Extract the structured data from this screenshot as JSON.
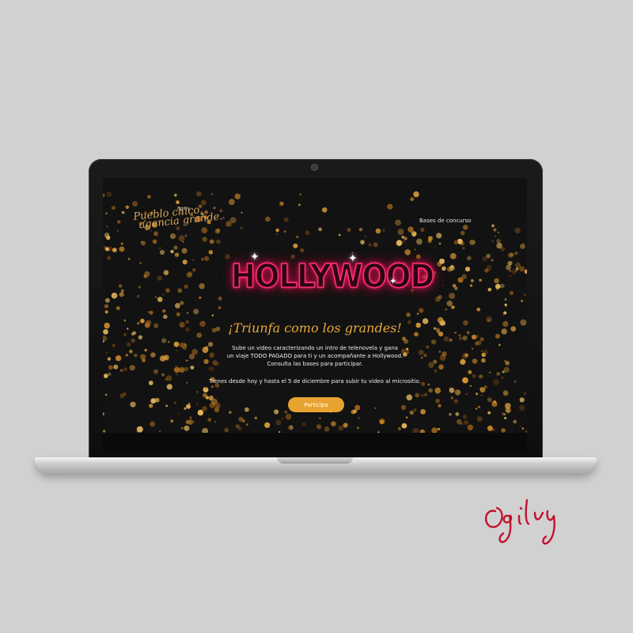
{
  "website": {
    "brand_small": "Ogilvy",
    "tagline_line1": "Pueblo chico,",
    "tagline_line2": "agencia grande.",
    "nav_link": "Bases de concurso",
    "hero_logo": "HOLLYWOOD",
    "headline": "¡Triunfa como los grandes!",
    "body_lines": [
      "Sube un video caracterizando un intro de telenovela y gana",
      "un viaje TODO PAGADO para ti y un acompañante a Hollywood.",
      "Consulta las bases para participar."
    ],
    "deadline": "Tienes desde hoy y hasta el 5 de diciembre para subir tu video al micrositio.",
    "cta_label": "Participa"
  },
  "signature_text": "Ogilvy",
  "colors": {
    "page_background": "#d1d1d1",
    "screen_background": "#121212",
    "gold_accent": "#e8a93a",
    "neon_pink": "#ff2f73",
    "cta_background": "#e7a431",
    "signature_red": "#c3122e"
  },
  "icons": [
    "camera-icon",
    "sparkle-icon"
  ]
}
